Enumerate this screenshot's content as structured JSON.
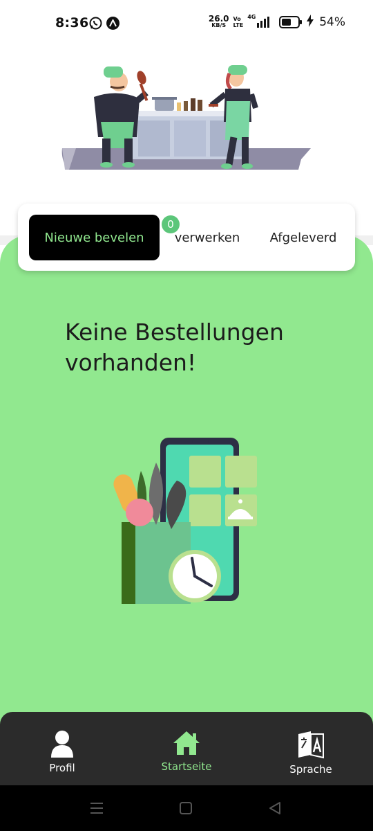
{
  "status_bar": {
    "time": "8:36",
    "net_speed_value": "26.0",
    "net_speed_unit": "KB/S",
    "volte_top": "Vo",
    "volte_bottom": "LTE",
    "network": "4G",
    "battery": "54%",
    "icons": [
      "whatsapp-icon",
      "app-a-icon",
      "signal-icon",
      "battery-icon",
      "charging-icon"
    ]
  },
  "tabs": {
    "new_orders": "Nieuwe bevelen",
    "processing": "verwerken",
    "processing_count": "0",
    "delivered": "Afgeleverd"
  },
  "empty_state": {
    "message": "Keine Bestellungen vorhanden!"
  },
  "bottom_nav": {
    "items": [
      {
        "label": "Profil",
        "icon": "user-icon"
      },
      {
        "label": "Startseite",
        "icon": "home-icon"
      },
      {
        "label": "Sprache",
        "icon": "translate-icon"
      }
    ]
  },
  "system_nav": {
    "icons": [
      "menu-icon",
      "home-square-icon",
      "back-icon"
    ]
  },
  "colors": {
    "accent_green": "#91e88f",
    "dark": "#2b2b2b",
    "badge": "#5cc67a"
  }
}
